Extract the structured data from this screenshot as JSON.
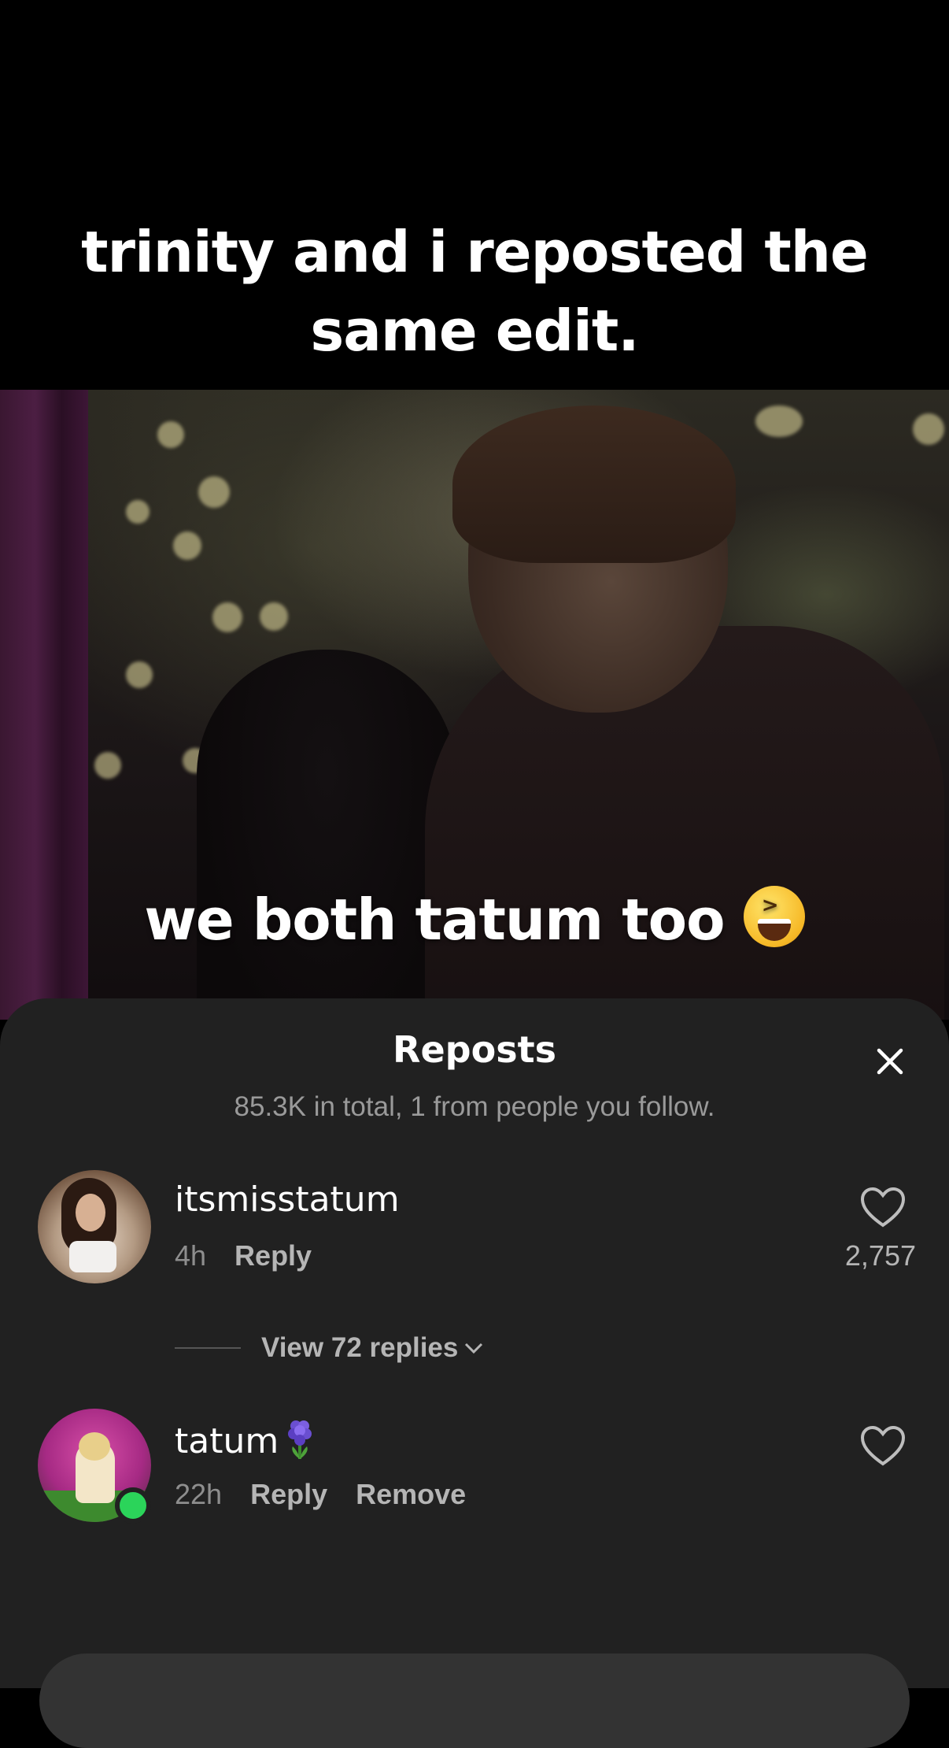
{
  "video": {
    "top_caption_line1": "trinity and i reposted the",
    "top_caption_line2": "same edit.",
    "overlay_text": "we both tatum too"
  },
  "sheet": {
    "title": "Reposts",
    "subtitle": "85.3K in total, 1 from people you follow."
  },
  "comments": [
    {
      "username": "itsmisstatum",
      "time": "4h",
      "actions": [
        "Reply"
      ],
      "likes": "2,757",
      "view_replies": "View 72 replies"
    },
    {
      "username": "tatum",
      "time": "22h",
      "actions": [
        "Reply",
        "Remove"
      ],
      "online": true
    }
  ],
  "icons": {
    "close": "close-icon",
    "like": "heart-outline-icon",
    "expand": "chevron-down-icon",
    "emoji": "grinning-squinting-face-emoji",
    "name_emoji": "hyacinth-emoji"
  },
  "colors": {
    "sheet_bg": "#212121",
    "online": "#2bd45a",
    "muted_text": "#9a9a9a"
  }
}
